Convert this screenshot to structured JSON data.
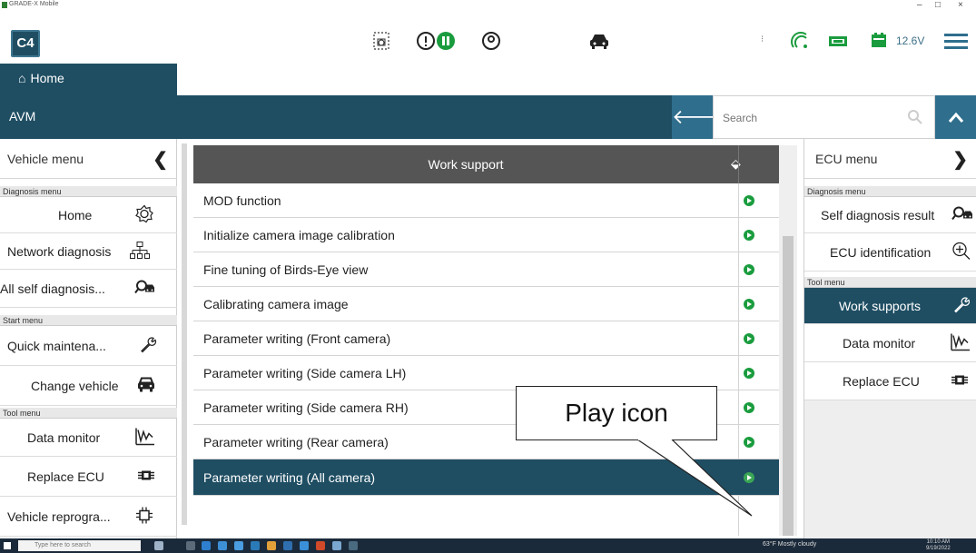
{
  "window": {
    "app_name": "GRADE-X Mobile",
    "minimize": "–",
    "maximize": "□",
    "close": "×"
  },
  "toolbar": {
    "logo_text": "C4",
    "voltage": "12.6V"
  },
  "home_tab": {
    "label": "Home",
    "icon": "house-icon"
  },
  "avm_bar": {
    "title": "AVM",
    "search_placeholder": "Search"
  },
  "left_panel": {
    "header": "Vehicle menu",
    "sections": [
      {
        "title": "Diagnosis menu",
        "items": [
          {
            "label": "Home",
            "icon": "gear-icon"
          },
          {
            "label": "Network diagnosis",
            "icon": "network-icon"
          },
          {
            "label": "All self diagnosis...",
            "icon": "diagnosis-car-icon"
          }
        ]
      },
      {
        "title": "Start menu",
        "items": [
          {
            "label": "Quick maintena...",
            "icon": "wrench-icon"
          },
          {
            "label": "Change vehicle",
            "icon": "car-icon"
          }
        ]
      },
      {
        "title": "Tool menu",
        "items": [
          {
            "label": "Data monitor",
            "icon": "waveform-icon"
          },
          {
            "label": "Replace ECU",
            "icon": "chip-icon"
          },
          {
            "label": "Vehicle reprogra...",
            "icon": "chip-outline-icon"
          }
        ]
      }
    ]
  },
  "work_table": {
    "header": "Work support",
    "rows": [
      {
        "label": "MOD function"
      },
      {
        "label": "Initialize camera image calibration"
      },
      {
        "label": "Fine tuning of Birds-Eye view"
      },
      {
        "label": "Calibrating camera image"
      },
      {
        "label": "Parameter writing (Front camera)"
      },
      {
        "label": "Parameter writing (Side camera LH)"
      },
      {
        "label": "Parameter writing (Side camera RH)"
      },
      {
        "label": "Parameter writing (Rear camera)"
      },
      {
        "label": "Parameter writing (All camera)",
        "selected": true
      }
    ]
  },
  "right_panel": {
    "header": "ECU menu",
    "sections": [
      {
        "title": "Diagnosis menu",
        "items": [
          {
            "label": "Self diagnosis result",
            "icon": "diagnosis-car-icon"
          },
          {
            "label": "ECU identification",
            "icon": "zoom-in-icon"
          }
        ]
      },
      {
        "title": "Tool menu",
        "items": [
          {
            "label": "Work supports",
            "icon": "wrench-icon",
            "active": true
          },
          {
            "label": "Data monitor",
            "icon": "waveform-icon"
          },
          {
            "label": "Replace ECU",
            "icon": "chip-icon"
          }
        ]
      }
    ]
  },
  "callout": {
    "text": "Play icon"
  },
  "taskbar": {
    "search_placeholder": "Type here to search",
    "weather": "63°F Mostly cloudy",
    "time": "10:10 AM",
    "date": "9/19/2022"
  },
  "colors": {
    "primary": "#1f4e63",
    "accent": "#2f6e8d",
    "play_green": "#1a9c3e",
    "table_header": "#555555"
  }
}
